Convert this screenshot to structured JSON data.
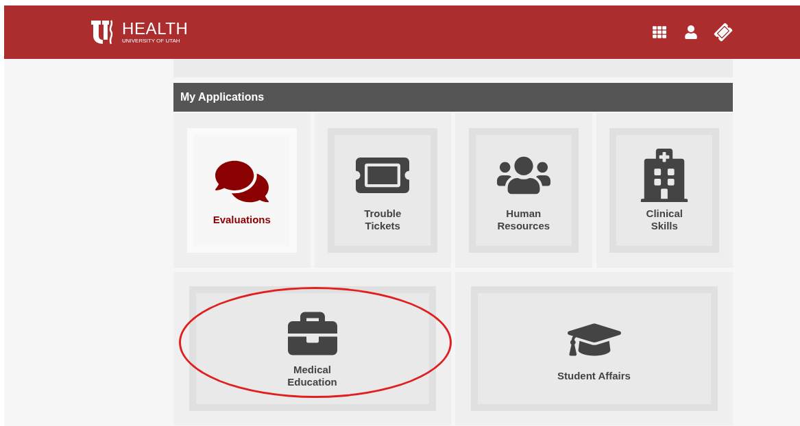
{
  "header": {
    "logo_title": "HEALTH",
    "logo_subtitle": "UNIVERSITY OF UTAH"
  },
  "section": {
    "title": "My Applications"
  },
  "tiles": [
    {
      "lines": [
        "Evaluations"
      ],
      "selected": true,
      "circled": false
    },
    {
      "lines": [
        "Trouble",
        "Tickets"
      ],
      "selected": false,
      "circled": false
    },
    {
      "lines": [
        "Human",
        "Resources"
      ],
      "selected": false,
      "circled": false
    },
    {
      "lines": [
        "Clinical",
        "Skills"
      ],
      "selected": false,
      "circled": false
    },
    {
      "lines": [
        "Medical",
        "Education"
      ],
      "selected": false,
      "circled": true
    },
    {
      "lines": [
        "Student Affairs"
      ],
      "selected": false,
      "circled": false
    }
  ]
}
